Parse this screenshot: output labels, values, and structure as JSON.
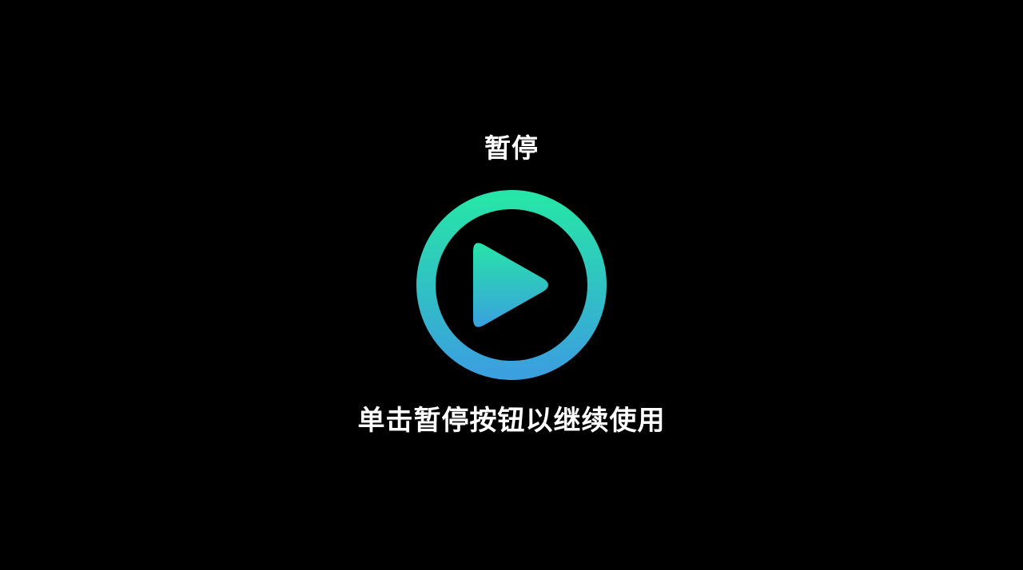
{
  "overlay": {
    "title": "暂停",
    "hint": "单击暂停按钮以继续使用"
  },
  "play_button": {
    "icon": "play-circle-icon",
    "gradient_top": "#27E4A8",
    "gradient_bottom": "#3AA0DE"
  },
  "colors": {
    "background": "#000000",
    "text": "#FFFFFF"
  }
}
